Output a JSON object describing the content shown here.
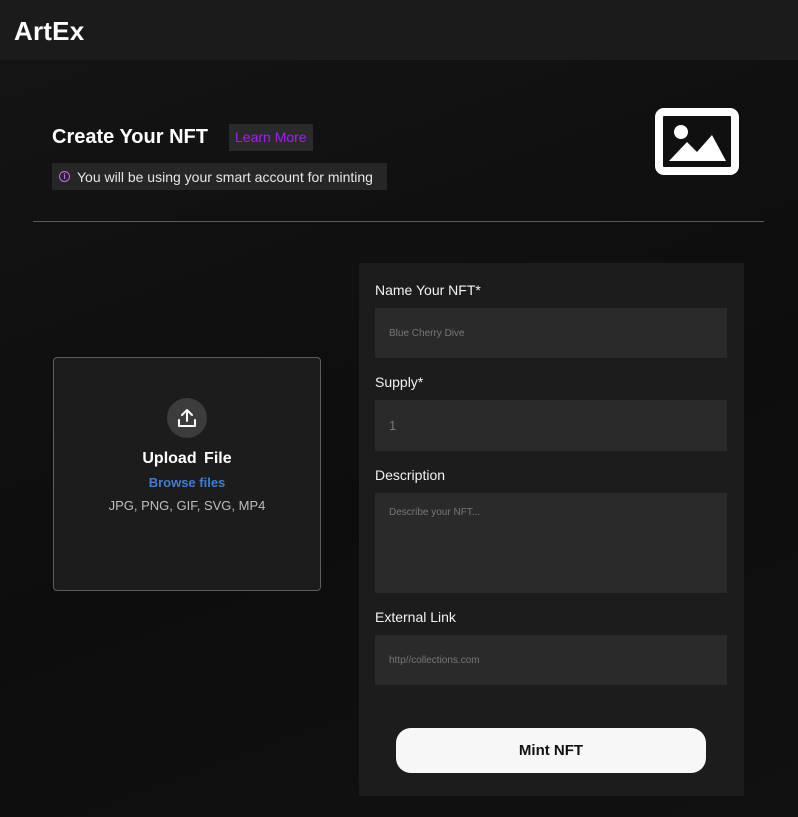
{
  "header": {
    "brand": "ArtEx"
  },
  "intro": {
    "title": "Create Your NFT",
    "learn_more": "Learn More",
    "notice": "You will be using your smart account for minting",
    "notice_icon": "info-icon"
  },
  "upload": {
    "icon": "upload-icon",
    "title": "Upload  File",
    "browse": "Browse files",
    "formats": "JPG, PNG, GIF, SVG, MP4"
  },
  "form": {
    "name_label": "Name Your NFT*",
    "name_placeholder": "Blue Cherry Dive",
    "supply_label": "Supply*",
    "supply_placeholder": "1",
    "description_label": "Description",
    "description_placeholder": "Describe your NFT...",
    "link_label": "External Link",
    "link_placeholder": "http//collections.com",
    "submit_label": "Mint NFT"
  },
  "colors": {
    "accent": "#a020f0",
    "link": "#3d7fd6",
    "panel": "#1c1c1c",
    "input": "#2a2a2a"
  }
}
